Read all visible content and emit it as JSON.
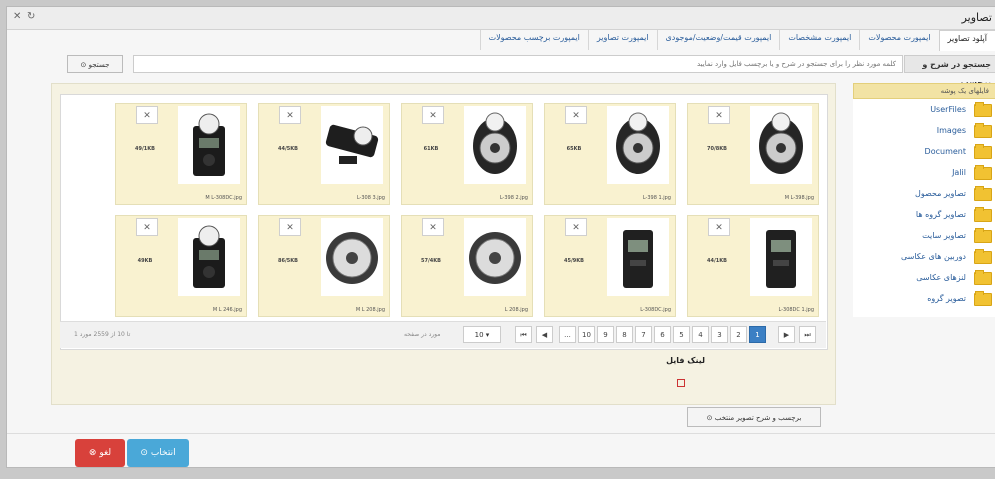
{
  "window": {
    "title": "تصاویر"
  },
  "tabs": [
    {
      "label": "آپلود تصاویر",
      "active": true
    },
    {
      "label": "ایمپورت محصولات",
      "active": false
    },
    {
      "label": "ایمپورت مشخصات",
      "active": false
    },
    {
      "label": "ایمپورت قیمت/وضعیت/موجودی",
      "active": false
    },
    {
      "label": "ایمپورت تصاویر",
      "active": false
    },
    {
      "label": "ایمپورت برچسب محصولات",
      "active": false
    }
  ],
  "search": {
    "label": "جستجو در شرح و برچسب",
    "placeholder": "کلمه مورد نظر را برای جستجو در شرح و یا برچسب فایل وارد نمایید",
    "button": "جستجو"
  },
  "sidebar": {
    "header": "فایلهای یک پوشه",
    "folders": [
      {
        "label": "UserFiles"
      },
      {
        "label": "Images"
      },
      {
        "label": "Document"
      },
      {
        "label": "Jalil"
      },
      {
        "label": "تصاویر محصول"
      },
      {
        "label": "تصاویر گروه ها"
      },
      {
        "label": "تصاویر سایت"
      },
      {
        "label": "دوربین های عکاسی"
      },
      {
        "label": "لنزهای عکاسی"
      },
      {
        "label": "تصویر گروه"
      }
    ]
  },
  "files": [
    {
      "name": "M L-398.jpg",
      "size": "70/8KB"
    },
    {
      "name": "L-398 1.jpg",
      "size": "65KB"
    },
    {
      "name": "L-398 2.jpg",
      "size": "61KB"
    },
    {
      "name": "L-308 3.jpg",
      "size": "44/5KB"
    },
    {
      "name": "M L-308DC.jpg",
      "size": "49/1KB"
    },
    {
      "name": "L-308DC 1.jpg",
      "size": "44/1KB"
    },
    {
      "name": "L-308DC.jpg",
      "size": "45/9KB"
    },
    {
      "name": "L 208.jpg",
      "size": "57/4KB"
    },
    {
      "name": "M L 208.jpg",
      "size": "86/5KB"
    },
    {
      "name": "M L 246.jpg",
      "size": "49KB"
    }
  ],
  "pager": {
    "pages": [
      "1",
      "2",
      "3",
      "4",
      "5",
      "6",
      "7",
      "8",
      "9",
      "10",
      "..."
    ],
    "current": "1",
    "per_page": "10",
    "per_page_label": "مورد در صفحه",
    "count_text": "1 تا 10 از 2559 مورد",
    "first": "⏮",
    "prev": "◀",
    "next": "▶",
    "last": "⏭"
  },
  "file_link": {
    "label": "لینک فایل"
  },
  "buttons": {
    "tags": "برچسب و شرح تصویر منتخب",
    "select": "انتخاب",
    "cancel": "لغو"
  },
  "colors": {
    "accent": "#3b7fc4",
    "cancel": "#d8413b",
    "select": "#4aa8d8"
  }
}
